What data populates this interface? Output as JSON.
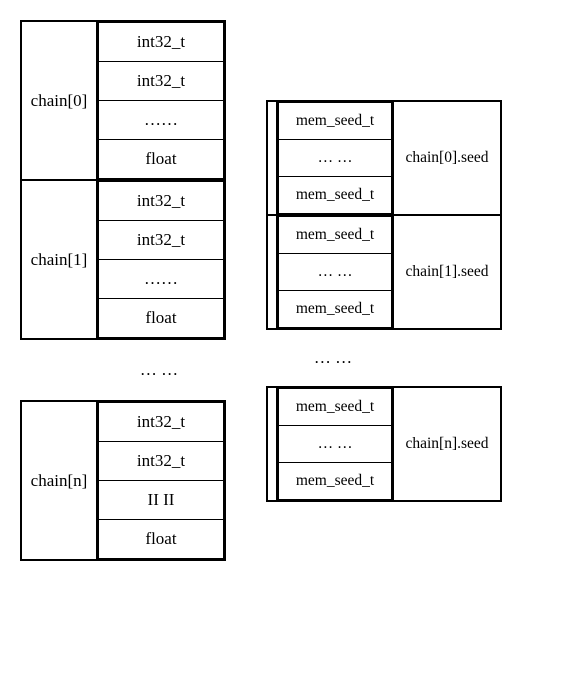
{
  "left": {
    "blocks": [
      {
        "label": "chain[0]",
        "cells": [
          "int32_t",
          "int32_t",
          "……",
          "float"
        ]
      },
      {
        "label": "chain[1]",
        "cells": [
          "int32_t",
          "int32_t",
          "……",
          "float"
        ]
      }
    ],
    "gap": "… …",
    "last": {
      "label": "chain[n]",
      "cells": [
        "int32_t",
        "int32_t",
        "II  II",
        "float"
      ]
    }
  },
  "right": {
    "blocks": [
      {
        "label": "chain[0].seed",
        "cells": [
          "mem_seed_t",
          "… …",
          "mem_seed_t"
        ]
      },
      {
        "label": "chain[1].seed",
        "cells": [
          "mem_seed_t",
          "… …",
          "mem_seed_t"
        ]
      }
    ],
    "gap": "… …",
    "last": {
      "label": "chain[n].seed",
      "cells": [
        "mem_seed_t",
        "… …",
        "mem_seed_t"
      ]
    }
  }
}
